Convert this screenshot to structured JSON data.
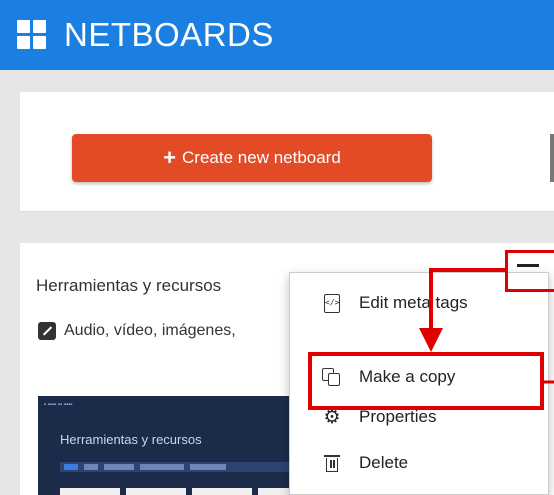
{
  "header": {
    "app_title": "NETBOARDS",
    "logo_icon": "grid-icon",
    "bg_color": "#1a7fe0"
  },
  "toolbar": {
    "create_label": "Create new netboard",
    "create_icon": "plus-icon",
    "create_color": "#e24b26"
  },
  "board": {
    "title": "Herramientas y recursos",
    "tags": "Audio, vídeo, imágenes,",
    "tags_icon": "pencil-icon",
    "thumbnail": {
      "heading": "Herramientas y recursos"
    }
  },
  "context_menu": {
    "trigger_icon": "hamburger-menu-icon",
    "items": [
      {
        "label": "Edit meta tags",
        "icon": "code-file-icon"
      },
      {
        "label": "Make a copy",
        "icon": "copy-icon"
      },
      {
        "label": "Properties",
        "icon": "gear-icon"
      },
      {
        "label": "Delete",
        "icon": "trash-icon"
      }
    ]
  },
  "annotation": {
    "highlight_color": "#e00000"
  }
}
